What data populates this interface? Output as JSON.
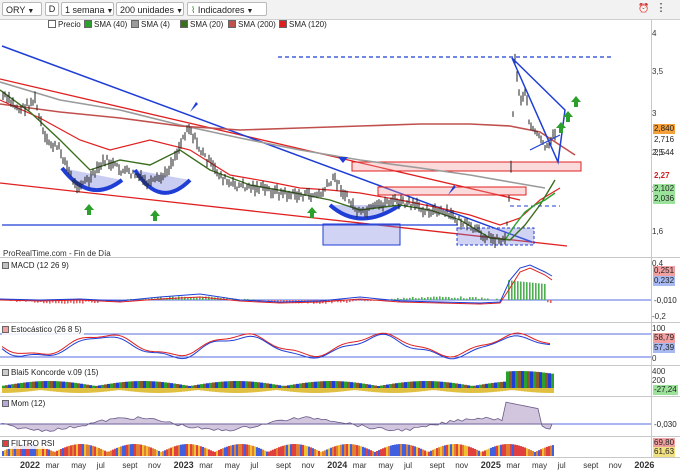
{
  "toolbar": {
    "symbol": "ORY",
    "mode": "D",
    "period": "1 semana",
    "units": "200 unidades",
    "indicators": "Indicadores"
  },
  "legend": [
    {
      "label": "Precio",
      "color": "#ffffff"
    },
    {
      "label": "SMA (40)",
      "color": "#2ca02c"
    },
    {
      "label": "SMA (4)",
      "color": "#9a9a9a"
    },
    {
      "label": "SMA (20)",
      "color": "#3b6e1e"
    },
    {
      "label": "SMA (200)",
      "color": "#c0504d"
    },
    {
      "label": "SMA (120)",
      "color": "#e02020"
    }
  ],
  "price_axis": {
    "ticks": [
      "4",
      "3,5",
      "3",
      "2,5",
      "2",
      "1,6"
    ],
    "tags": [
      {
        "value": "2,840",
        "bg": "#f6a03a"
      },
      {
        "value": "2,716",
        "bg": "#ffffff"
      },
      {
        "value": "2,544",
        "bg": "#ffffff"
      },
      {
        "value": "2,27",
        "bg": "#ffffff",
        "color": "#d02020"
      },
      {
        "value": "2,102",
        "bg": "#9be39b"
      },
      {
        "value": "2,036",
        "bg": "#9be39b"
      }
    ]
  },
  "watermark": "ProRealTime.com - Fin de Día",
  "panels": {
    "macd": {
      "label": "MACD (12 26 9)",
      "ticks": [
        "0,4"
      ],
      "tags": [
        "0,251",
        "0,232",
        "-0,010",
        "-0,2"
      ]
    },
    "stoch": {
      "label": "Estocástico (26 8 5)",
      "ticks": [
        "100"
      ],
      "tags": [
        "58,79",
        "57,39",
        "0"
      ]
    },
    "blai": {
      "label": "Blai5 Koncorde v.09 (15)",
      "ticks": [
        "400",
        "200"
      ],
      "tags": [
        "-27,24"
      ]
    },
    "mom": {
      "label": "Mom (12)",
      "tags": [
        "-0,030"
      ]
    },
    "rsi": {
      "label": "FILTRO RSI",
      "tags": [
        "69,80",
        "61,63"
      ]
    }
  },
  "x_axis": [
    {
      "label": "2022",
      "year": true
    },
    {
      "label": "mar"
    },
    {
      "label": "may"
    },
    {
      "label": "jul"
    },
    {
      "label": "sept"
    },
    {
      "label": "nov"
    },
    {
      "label": "2023",
      "year": true
    },
    {
      "label": "mar"
    },
    {
      "label": "may"
    },
    {
      "label": "jul"
    },
    {
      "label": "sept"
    },
    {
      "label": "nov"
    },
    {
      "label": "2024",
      "year": true
    },
    {
      "label": "mar"
    },
    {
      "label": "may"
    },
    {
      "label": "jul"
    },
    {
      "label": "sept"
    },
    {
      "label": "nov"
    },
    {
      "label": "2025",
      "year": true
    },
    {
      "label": "mar"
    },
    {
      "label": "may"
    },
    {
      "label": "jul"
    },
    {
      "label": "sept"
    },
    {
      "label": "nov"
    },
    {
      "label": "2026",
      "year": true
    }
  ]
}
